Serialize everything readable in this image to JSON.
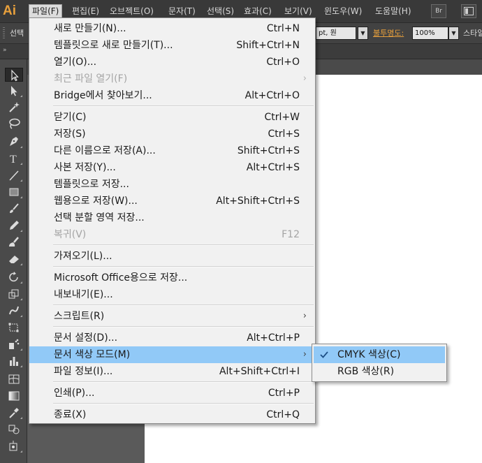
{
  "app": {
    "logo_text": "Ai"
  },
  "menubar": {
    "items": [
      {
        "label": "파일(F)",
        "active": true
      },
      {
        "label": "편집(E)"
      },
      {
        "label": "오브젝트(O)"
      },
      {
        "label": "문자(T)"
      },
      {
        "label": "선택(S)"
      },
      {
        "label": "효과(C)"
      },
      {
        "label": "보기(V)"
      },
      {
        "label": "윈도우(W)"
      },
      {
        "label": "도움말(H)"
      }
    ],
    "bridge_label": "Br"
  },
  "controlbar": {
    "selection_label": "선택",
    "font_size_value": "pt, 원",
    "opacity_label": "불투명도:",
    "opacity_value": "100%",
    "style_label": "스타일"
  },
  "file_menu": {
    "groups": [
      [
        {
          "label": "새로 만들기(N)...",
          "shortcut": "Ctrl+N"
        },
        {
          "label": "템플릿으로 새로 만들기(T)...",
          "shortcut": "Shift+Ctrl+N"
        },
        {
          "label": "열기(O)...",
          "shortcut": "Ctrl+O"
        },
        {
          "label": "최근 파일 열기(F)",
          "shortcut": "",
          "disabled": true,
          "submenu": true
        },
        {
          "label": "Bridge에서 찾아보기...",
          "shortcut": "Alt+Ctrl+O"
        }
      ],
      [
        {
          "label": "닫기(C)",
          "shortcut": "Ctrl+W"
        },
        {
          "label": "저장(S)",
          "shortcut": "Ctrl+S"
        },
        {
          "label": "다른 이름으로 저장(A)...",
          "shortcut": "Shift+Ctrl+S"
        },
        {
          "label": "사본 저장(Y)...",
          "shortcut": "Alt+Ctrl+S"
        },
        {
          "label": "템플릿으로 저장...",
          "shortcut": ""
        },
        {
          "label": "웹용으로 저장(W)...",
          "shortcut": "Alt+Shift+Ctrl+S"
        },
        {
          "label": "선택 분할 영역 저장...",
          "shortcut": ""
        },
        {
          "label": "복귀(V)",
          "shortcut": "F12",
          "disabled": true
        }
      ],
      [
        {
          "label": "가져오기(L)...",
          "shortcut": ""
        }
      ],
      [
        {
          "label": "Microsoft Office용으로 저장...",
          "shortcut": ""
        },
        {
          "label": "내보내기(E)...",
          "shortcut": ""
        }
      ],
      [
        {
          "label": "스크립트(R)",
          "shortcut": "",
          "submenu": true
        }
      ],
      [
        {
          "label": "문서 설정(D)...",
          "shortcut": "Alt+Ctrl+P"
        },
        {
          "label": "문서 색상 모드(M)",
          "shortcut": "",
          "submenu": true,
          "highlighted": true
        },
        {
          "label": "파일 정보(I)...",
          "shortcut": "Alt+Shift+Ctrl+I"
        }
      ],
      [
        {
          "label": "인쇄(P)...",
          "shortcut": "Ctrl+P"
        }
      ],
      [
        {
          "label": "종료(X)",
          "shortcut": "Ctrl+Q"
        }
      ]
    ]
  },
  "color_mode_submenu": {
    "items": [
      {
        "label": "CMYK 색상(C)",
        "checked": true
      },
      {
        "label": "RGB 색상(R)",
        "checked": false
      }
    ]
  },
  "tools": [
    "selection-tool",
    "direct-selection-tool",
    "magic-wand-tool",
    "lasso-tool",
    "pen-tool",
    "type-tool",
    "line-segment-tool",
    "rectangle-tool",
    "paintbrush-tool",
    "pencil-tool",
    "blob-brush-tool",
    "eraser-tool",
    "rotate-tool",
    "scale-tool",
    "warp-tool",
    "free-transform-tool",
    "symbol-sprayer-tool",
    "column-graph-tool",
    "mesh-tool",
    "gradient-tool",
    "eyedropper-tool",
    "blend-tool",
    "live-paint-bucket-tool"
  ],
  "colors": {
    "menu_highlight": "#91c9f7",
    "logo_accent": "#e8a03c",
    "menu_bg": "#f1f1f1"
  }
}
